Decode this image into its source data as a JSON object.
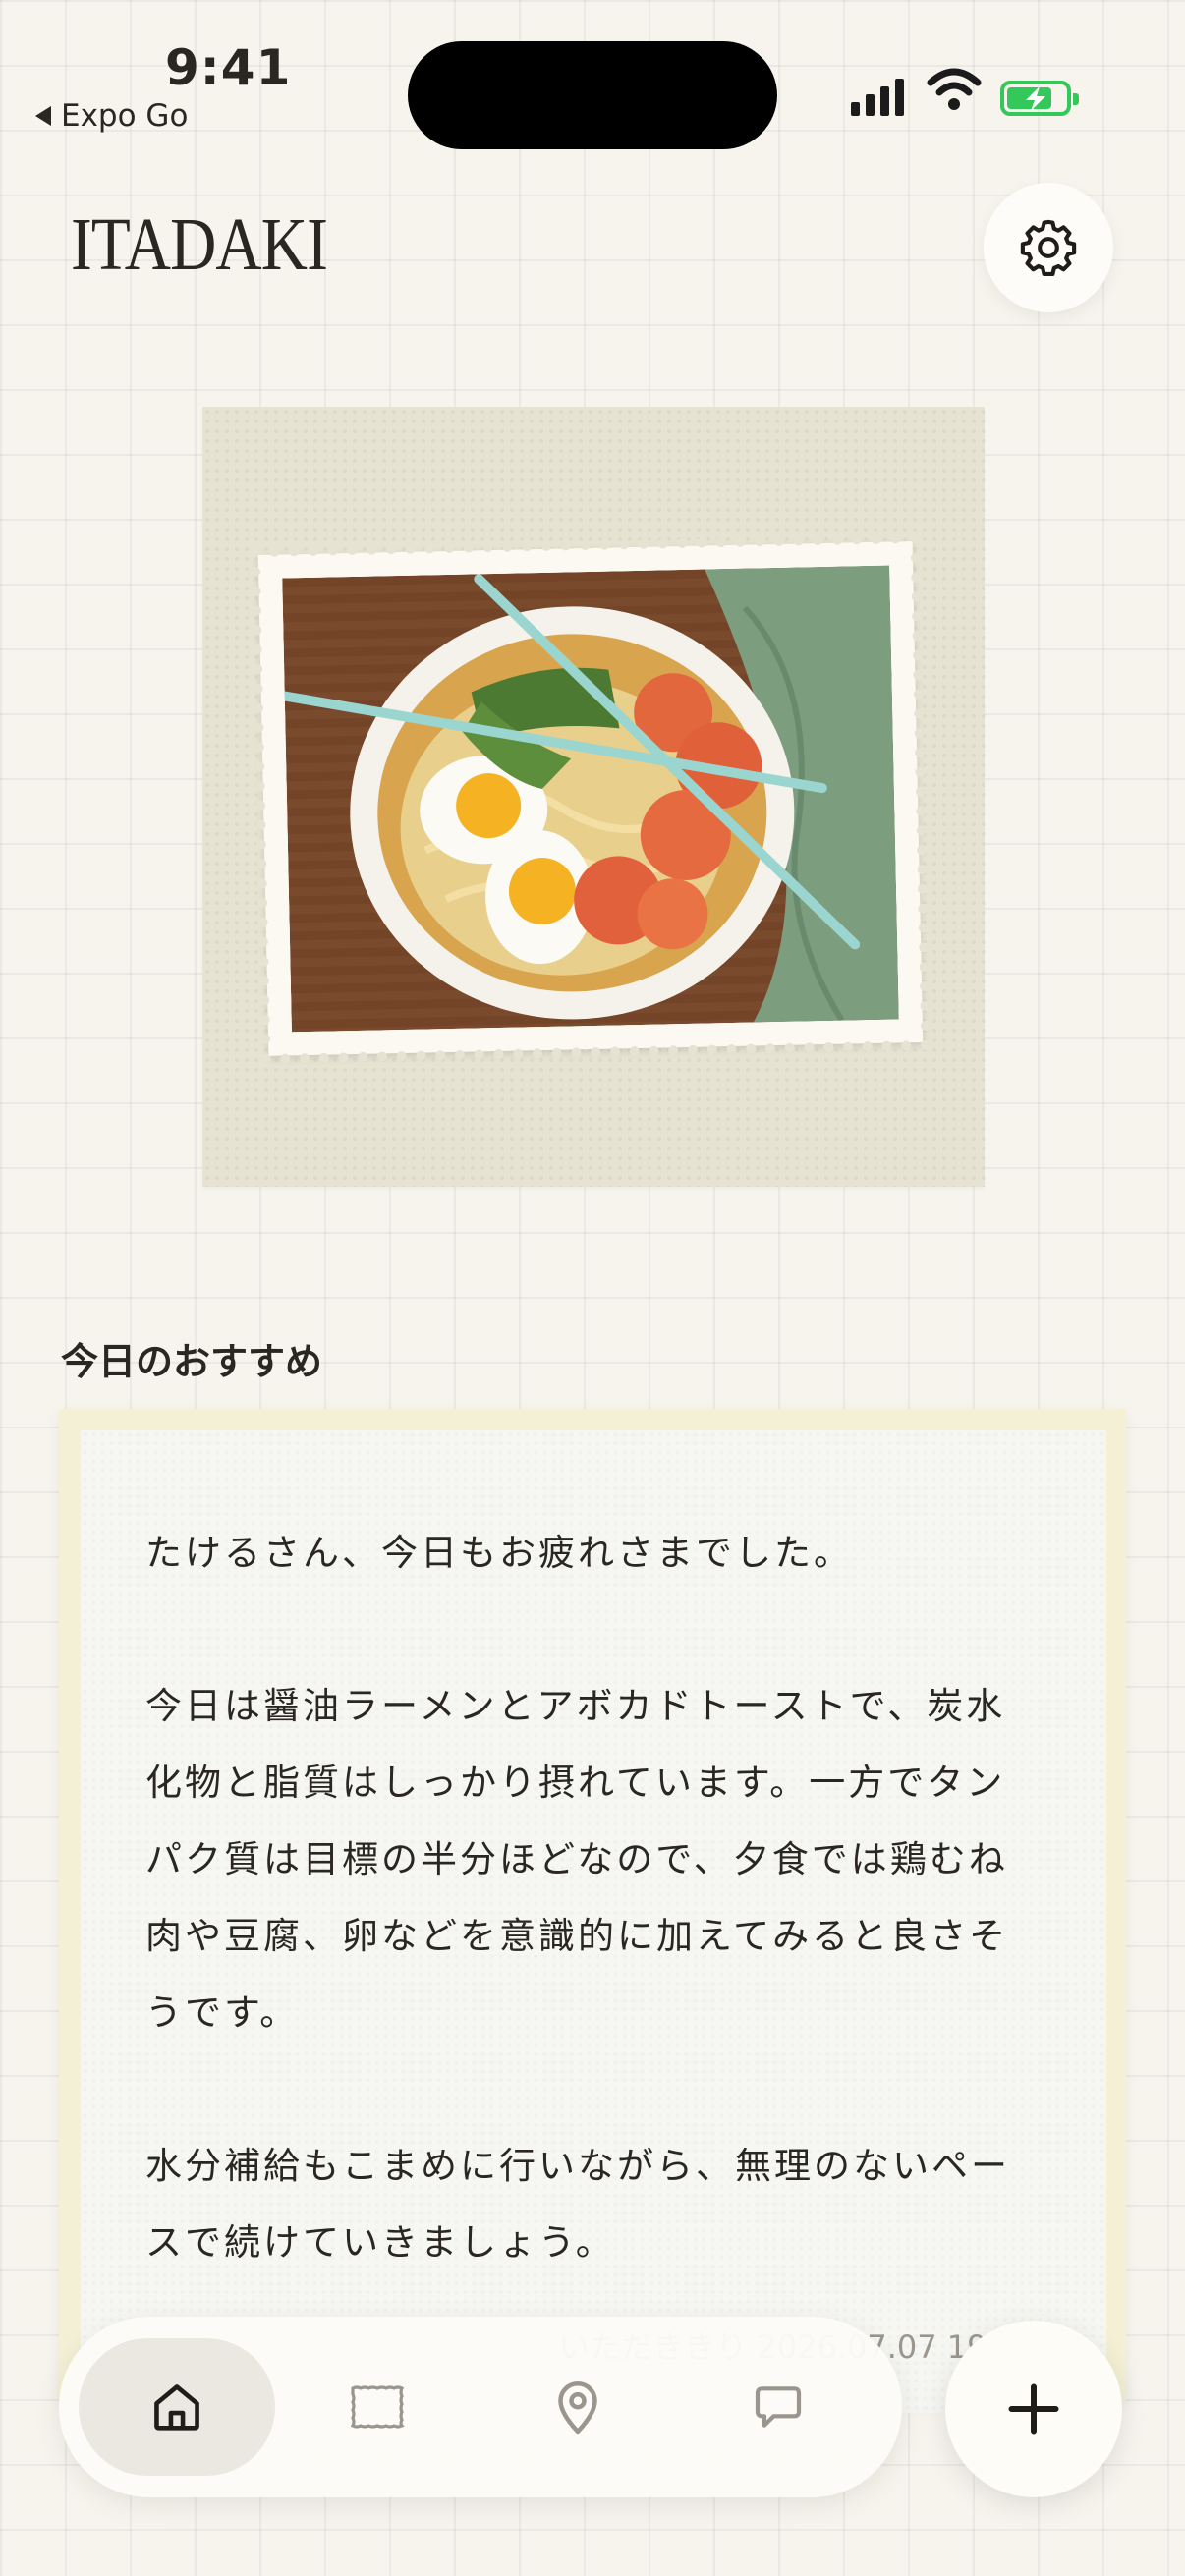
{
  "status_bar": {
    "time": "9:41",
    "back_app": "Expo Go"
  },
  "header": {
    "logo": "ITADAKI"
  },
  "section": {
    "title": "今日のおすすめ"
  },
  "recommendation": {
    "greeting": "たけるさん、今日もお疲れさまでした。",
    "body": "今日は醤油ラーメンとアボカドトーストで、炭水化物と脂質はしっかり摂れています。一方でタンパク質は目標の半分ほどなので、夕食では鶏むね肉や豆腐、卵などを意識的に加えてみると良さそうです。",
    "closing": "水分補給もこまめに行いながら、無理のないペースで続けていきましょう。",
    "footer": "いただききり 2026.07.07 19:55"
  },
  "tabbar": {
    "items": [
      {
        "icon": "home-icon",
        "active": true
      },
      {
        "icon": "stamp-icon",
        "active": false
      },
      {
        "icon": "map-pin-icon",
        "active": false
      },
      {
        "icon": "chat-bubble-icon",
        "active": false
      }
    ],
    "fab_icon": "plus-icon"
  },
  "colors": {
    "background": "#f7f4ee",
    "card_border": "#f4f0d6",
    "battery": "#34c759",
    "text": "#2a2622"
  }
}
